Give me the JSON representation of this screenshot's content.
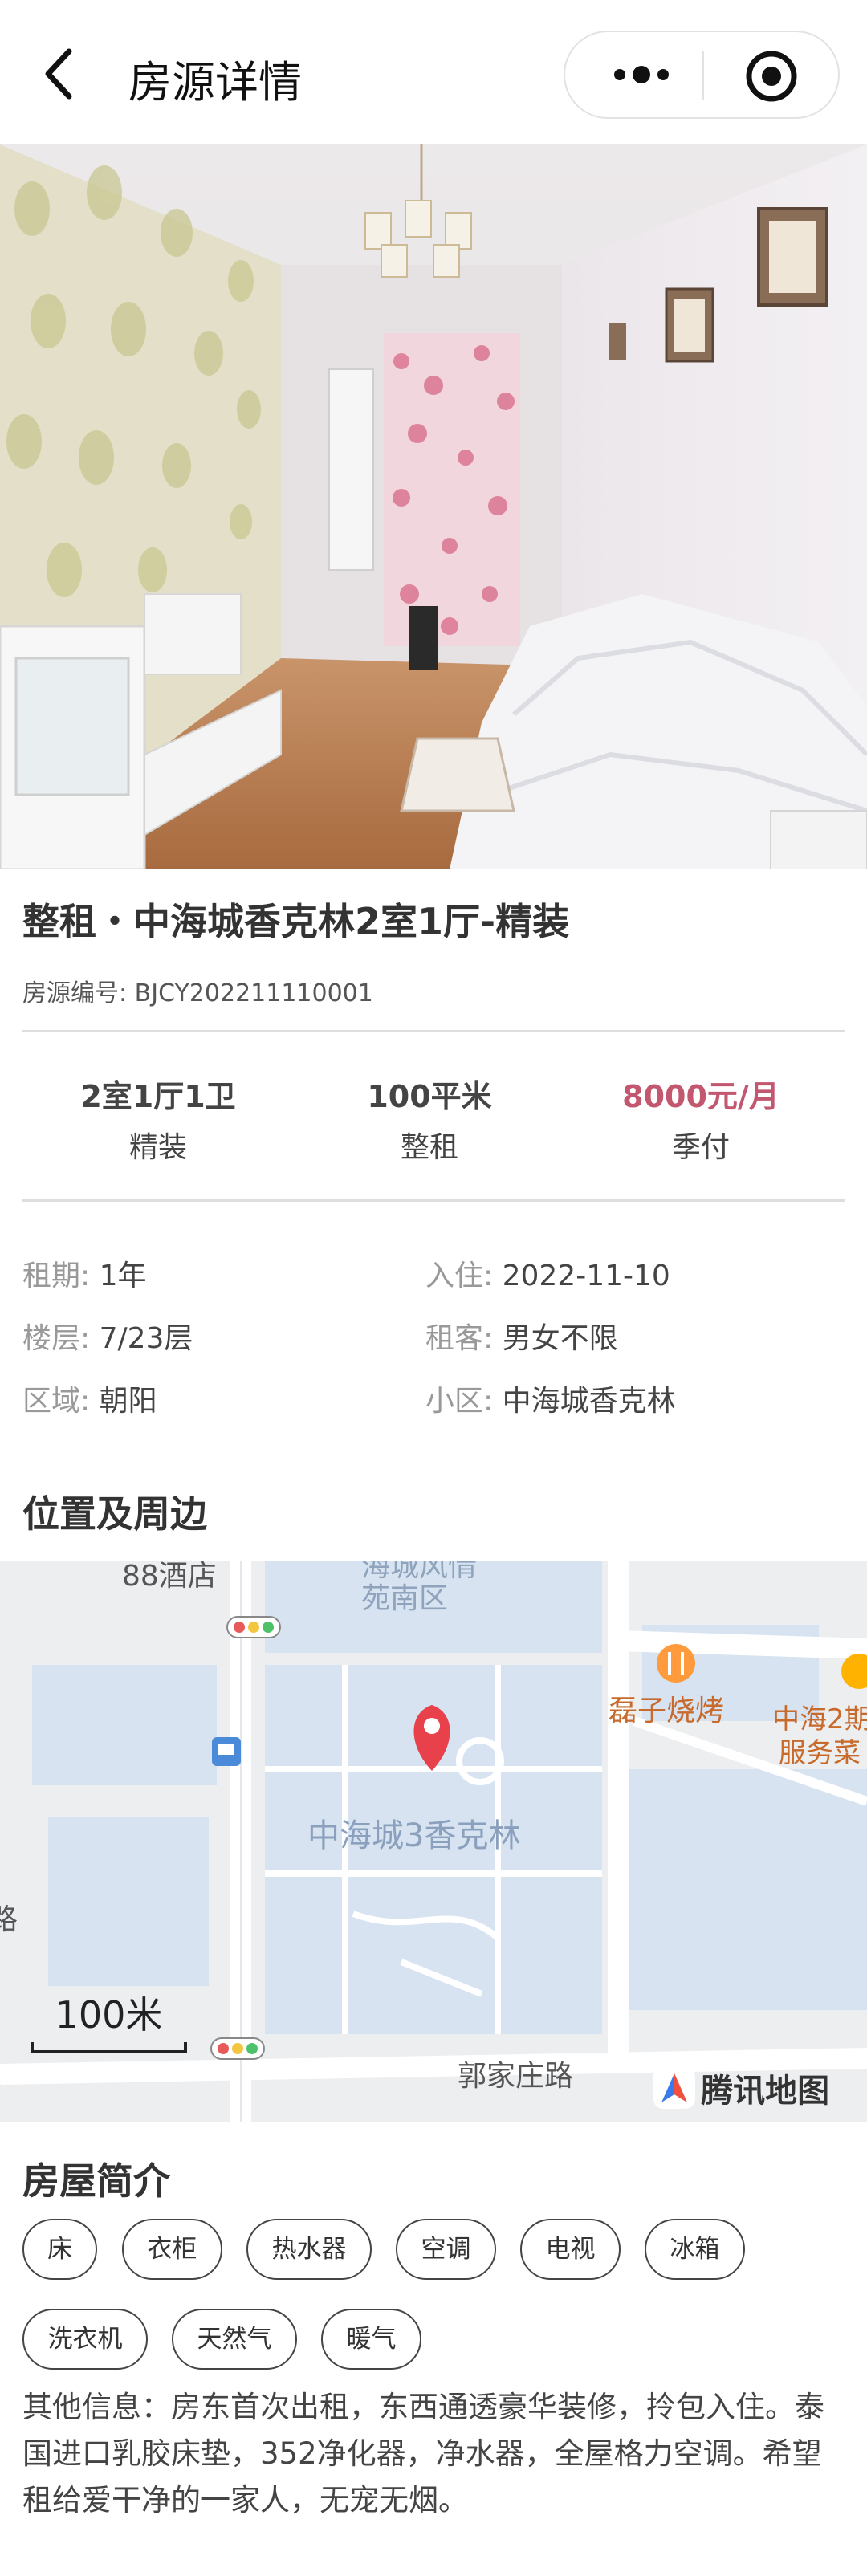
{
  "nav": {
    "title": "房源详情"
  },
  "gallery": {
    "image_count": 5,
    "active_index": 1
  },
  "listing": {
    "title": "整租・中海城香克林2室1厅-精装",
    "code": "房源编号: BJCY202211110001"
  },
  "stats": [
    {
      "value": "2室1厅1卫",
      "sub": "精装"
    },
    {
      "value": "100平米",
      "sub": "整租"
    },
    {
      "value": "8000元/月",
      "sub": "季付"
    }
  ],
  "details": [
    {
      "key": "租期:",
      "value": "1年"
    },
    {
      "key": "入住:",
      "value": "2022-11-10"
    },
    {
      "key": "楼层:",
      "value": "7/23层"
    },
    {
      "key": "租客:",
      "value": "男女不限"
    },
    {
      "key": "区域:",
      "value": "朝阳"
    },
    {
      "key": "小区:",
      "value": "中海城香克林"
    }
  ],
  "location": {
    "heading": "位置及周边",
    "map": {
      "labels": {
        "hotel": "88酒店",
        "district": "苑南区",
        "district_top": "海城风情",
        "bbq": "磊子烧烤",
        "service1": "中海2期",
        "service2": "服务菜",
        "community": "中海城3香克林",
        "road": "郭家庄路",
        "road_left": "路",
        "scale": "100米",
        "brand": "腾讯地图"
      }
    }
  },
  "intro": {
    "heading": "房屋简介",
    "tags": [
      "床",
      "衣柜",
      "热水器",
      "空调",
      "电视",
      "冰箱",
      "洗衣机",
      "天然气",
      "暖气"
    ],
    "description": "其他信息：房东首次出租，东西通透豪华装修，拎包入住。泰国进口乳胶床垫，352净化器，净水器，全屋格力空调。希望租给爱干净的一家人，无宠无烟。"
  },
  "colors": {
    "price": "#c2576f",
    "map_block": "#dbe6f2",
    "map_road": "#ffffff",
    "pin": "#e8414b"
  }
}
